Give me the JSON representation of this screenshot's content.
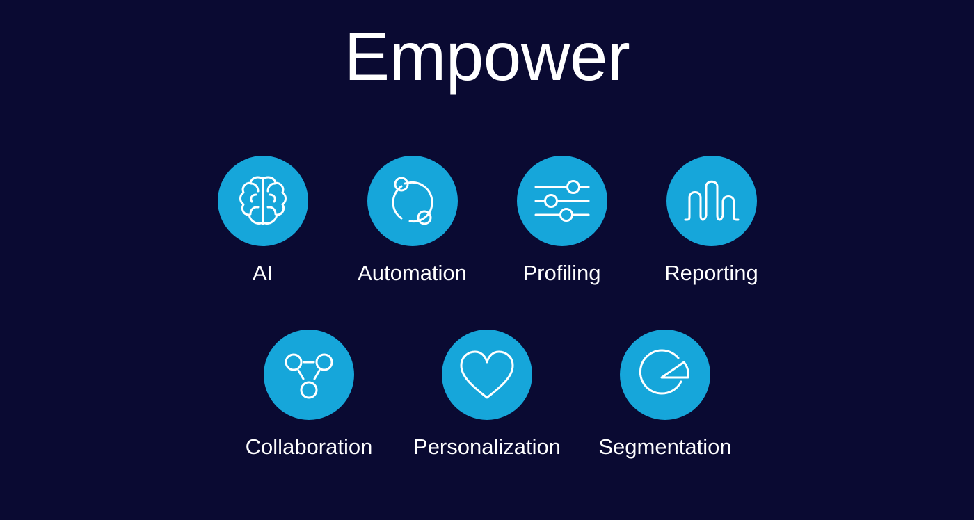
{
  "slide": {
    "title": "Empower",
    "background_color": "#0a0a32",
    "accent_color": "#16a6da",
    "text_color": "#ffffff"
  },
  "rows": [
    {
      "row_name": "feature-row-1",
      "items": [
        {
          "label": "AI",
          "icon": "brain-icon"
        },
        {
          "label": "Automation",
          "icon": "cycle-nodes-icon"
        },
        {
          "label": "Profiling",
          "icon": "sliders-icon"
        },
        {
          "label": "Reporting",
          "icon": "wave-chart-icon"
        }
      ]
    },
    {
      "row_name": "feature-row-2",
      "items": [
        {
          "label": "Collaboration",
          "icon": "network-nodes-icon"
        },
        {
          "label": "Personalization",
          "icon": "heart-icon"
        },
        {
          "label": "Segmentation",
          "icon": "pie-chart-icon"
        }
      ]
    }
  ]
}
